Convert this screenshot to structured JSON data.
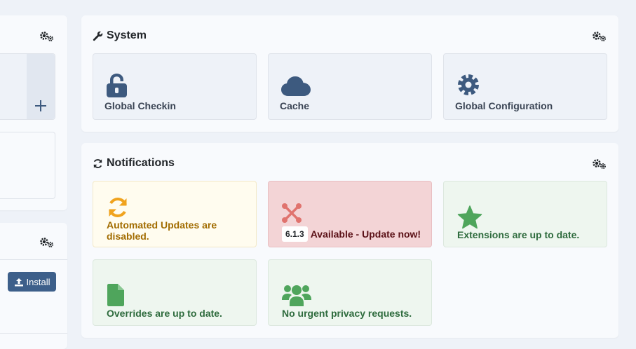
{
  "system": {
    "title": "System",
    "tiles": [
      {
        "label": "Global Checkin",
        "icon": "lock-open-icon"
      },
      {
        "label": "Cache",
        "icon": "cloud-icon"
      },
      {
        "label": "Global Configuration",
        "icon": "cog-icon"
      }
    ]
  },
  "notifications": {
    "title": "Notifications",
    "tiles": [
      {
        "label_line1": "Automated Updates are",
        "label_line2": "disabled.",
        "icon": "sync-icon",
        "status": "warning"
      },
      {
        "version": "6.1.3",
        "label": "Available - Update now!",
        "icon": "joomla-icon",
        "status": "danger"
      },
      {
        "label": "Extensions are up to date.",
        "icon": "star-icon",
        "status": "success"
      },
      {
        "label": "Overrides are up to date.",
        "icon": "file-icon",
        "status": "success"
      },
      {
        "label": "No urgent privacy requests.",
        "icon": "users-icon",
        "status": "success"
      }
    ]
  },
  "left_panel": {
    "install_button": "Install"
  },
  "colors": {
    "icon_blue": "#3d5a7f",
    "warning": "#f0a31e",
    "danger_icon": "#e0736e",
    "success": "#4fa55c"
  }
}
